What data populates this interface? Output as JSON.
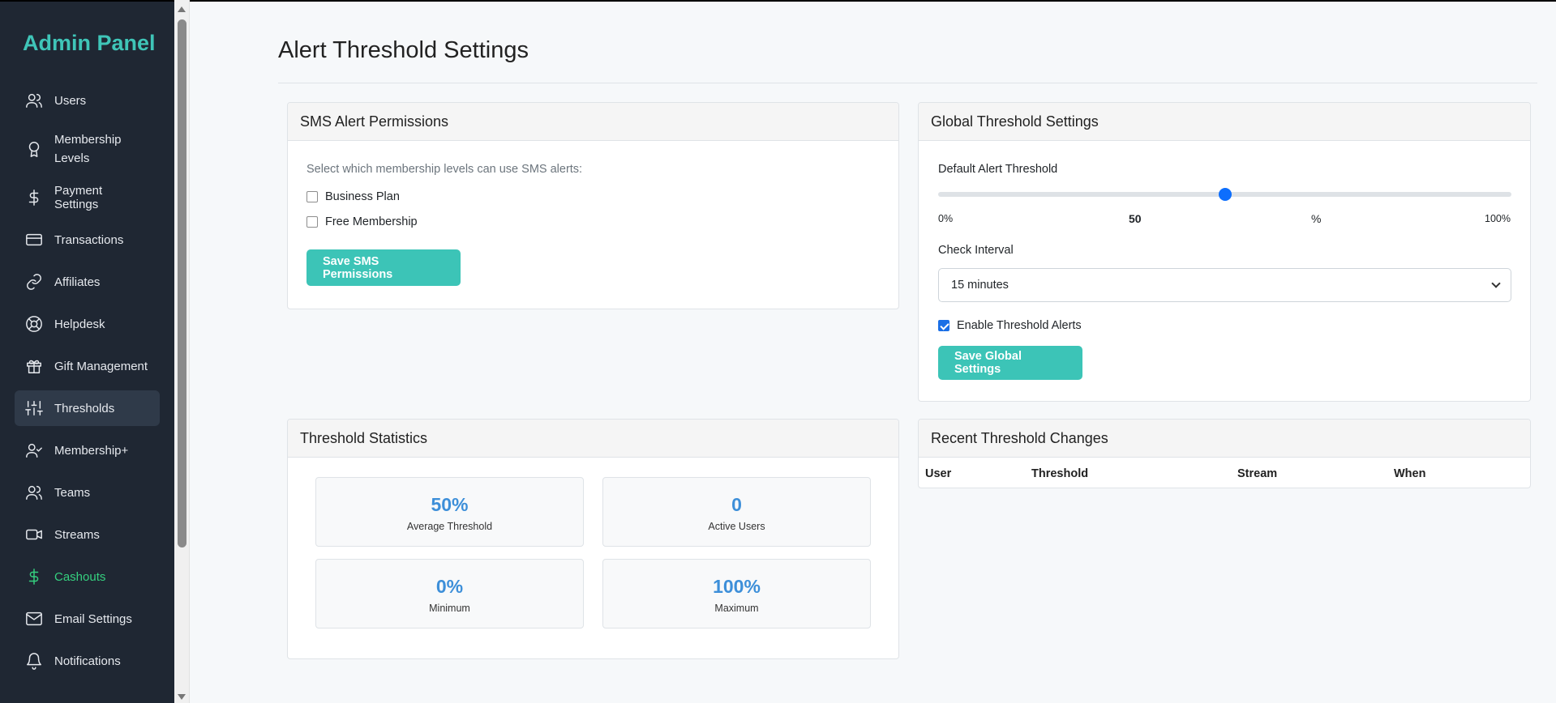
{
  "sidebar": {
    "brand": "Admin Panel",
    "items": [
      {
        "label": "Users",
        "icon": "users-icon"
      },
      {
        "label": "Membership Levels",
        "icon": "award-icon"
      },
      {
        "label": "Payment Settings",
        "icon": "dollar-icon"
      },
      {
        "label": "Transactions",
        "icon": "credit-card-icon"
      },
      {
        "label": "Affiliates",
        "icon": "link-icon"
      },
      {
        "label": "Helpdesk",
        "icon": "lifebuoy-icon"
      },
      {
        "label": "Gift Management",
        "icon": "gift-icon"
      },
      {
        "label": "Thresholds",
        "icon": "sliders-icon",
        "active": true
      },
      {
        "label": "Membership+",
        "icon": "user-check-icon"
      },
      {
        "label": "Teams",
        "icon": "team-icon"
      },
      {
        "label": "Streams",
        "icon": "video-icon"
      },
      {
        "label": "Cashouts",
        "icon": "dollar-icon",
        "color": "#35d07f"
      },
      {
        "label": "Email Settings",
        "icon": "mail-icon"
      },
      {
        "label": "Notifications",
        "icon": "bell-icon"
      }
    ]
  },
  "page": {
    "title": "Alert Threshold Settings"
  },
  "sms": {
    "title": "SMS Alert Permissions",
    "description": "Select which membership levels can use SMS alerts:",
    "options": [
      {
        "label": "Business Plan",
        "checked": false
      },
      {
        "label": "Free Membership",
        "checked": false
      }
    ],
    "save_label": "Save SMS Permissions"
  },
  "global": {
    "title": "Global Threshold Settings",
    "threshold_label": "Default Alert Threshold",
    "threshold_value": 50,
    "min_label": "0%",
    "value_label": "50",
    "unit_label": "%",
    "max_label": "100%",
    "interval_label": "Check Interval",
    "interval_value": "15 minutes",
    "enable_label": "Enable Threshold Alerts",
    "enable_checked": true,
    "save_label": "Save Global Settings"
  },
  "stats": {
    "title": "Threshold Statistics",
    "items": [
      {
        "value": "50%",
        "label": "Average Threshold"
      },
      {
        "value": "0",
        "label": "Active Users"
      },
      {
        "value": "0%",
        "label": "Minimum"
      },
      {
        "value": "100%",
        "label": "Maximum"
      }
    ]
  },
  "recent": {
    "title": "Recent Threshold Changes",
    "columns": [
      "User",
      "Threshold",
      "Stream",
      "When"
    ]
  },
  "colors": {
    "accent": "#3cc4b7",
    "brand": "#3fc5b8",
    "sidebar_bg": "#1f2733",
    "stat_value": "#3d8fd9",
    "cashout_green": "#35d07f"
  }
}
